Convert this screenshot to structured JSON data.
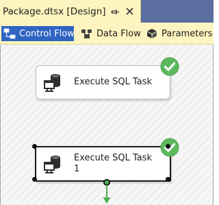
{
  "document_tab": {
    "title": "Package.dtsx [Design]"
  },
  "designer_tabs": [
    {
      "label": "Control Flow",
      "icon": "control-flow-icon",
      "selected": true
    },
    {
      "label": "Data Flow",
      "icon": "data-flow-icon",
      "selected": false
    },
    {
      "label": "Parameters",
      "icon": "parameters-icon",
      "selected": false
    }
  ],
  "tasks": [
    {
      "line1": "Execute SQL Task",
      "line2": "",
      "status": "success",
      "selected": false
    },
    {
      "line1": "Execute SQL Task",
      "line2": "1",
      "status": "success",
      "selected": true
    }
  ],
  "colors": {
    "tab_background": "#fdf4bf",
    "selected_tab": "#2f64c2",
    "success_green": "#5cb85c",
    "connector_green": "#4caf50"
  }
}
